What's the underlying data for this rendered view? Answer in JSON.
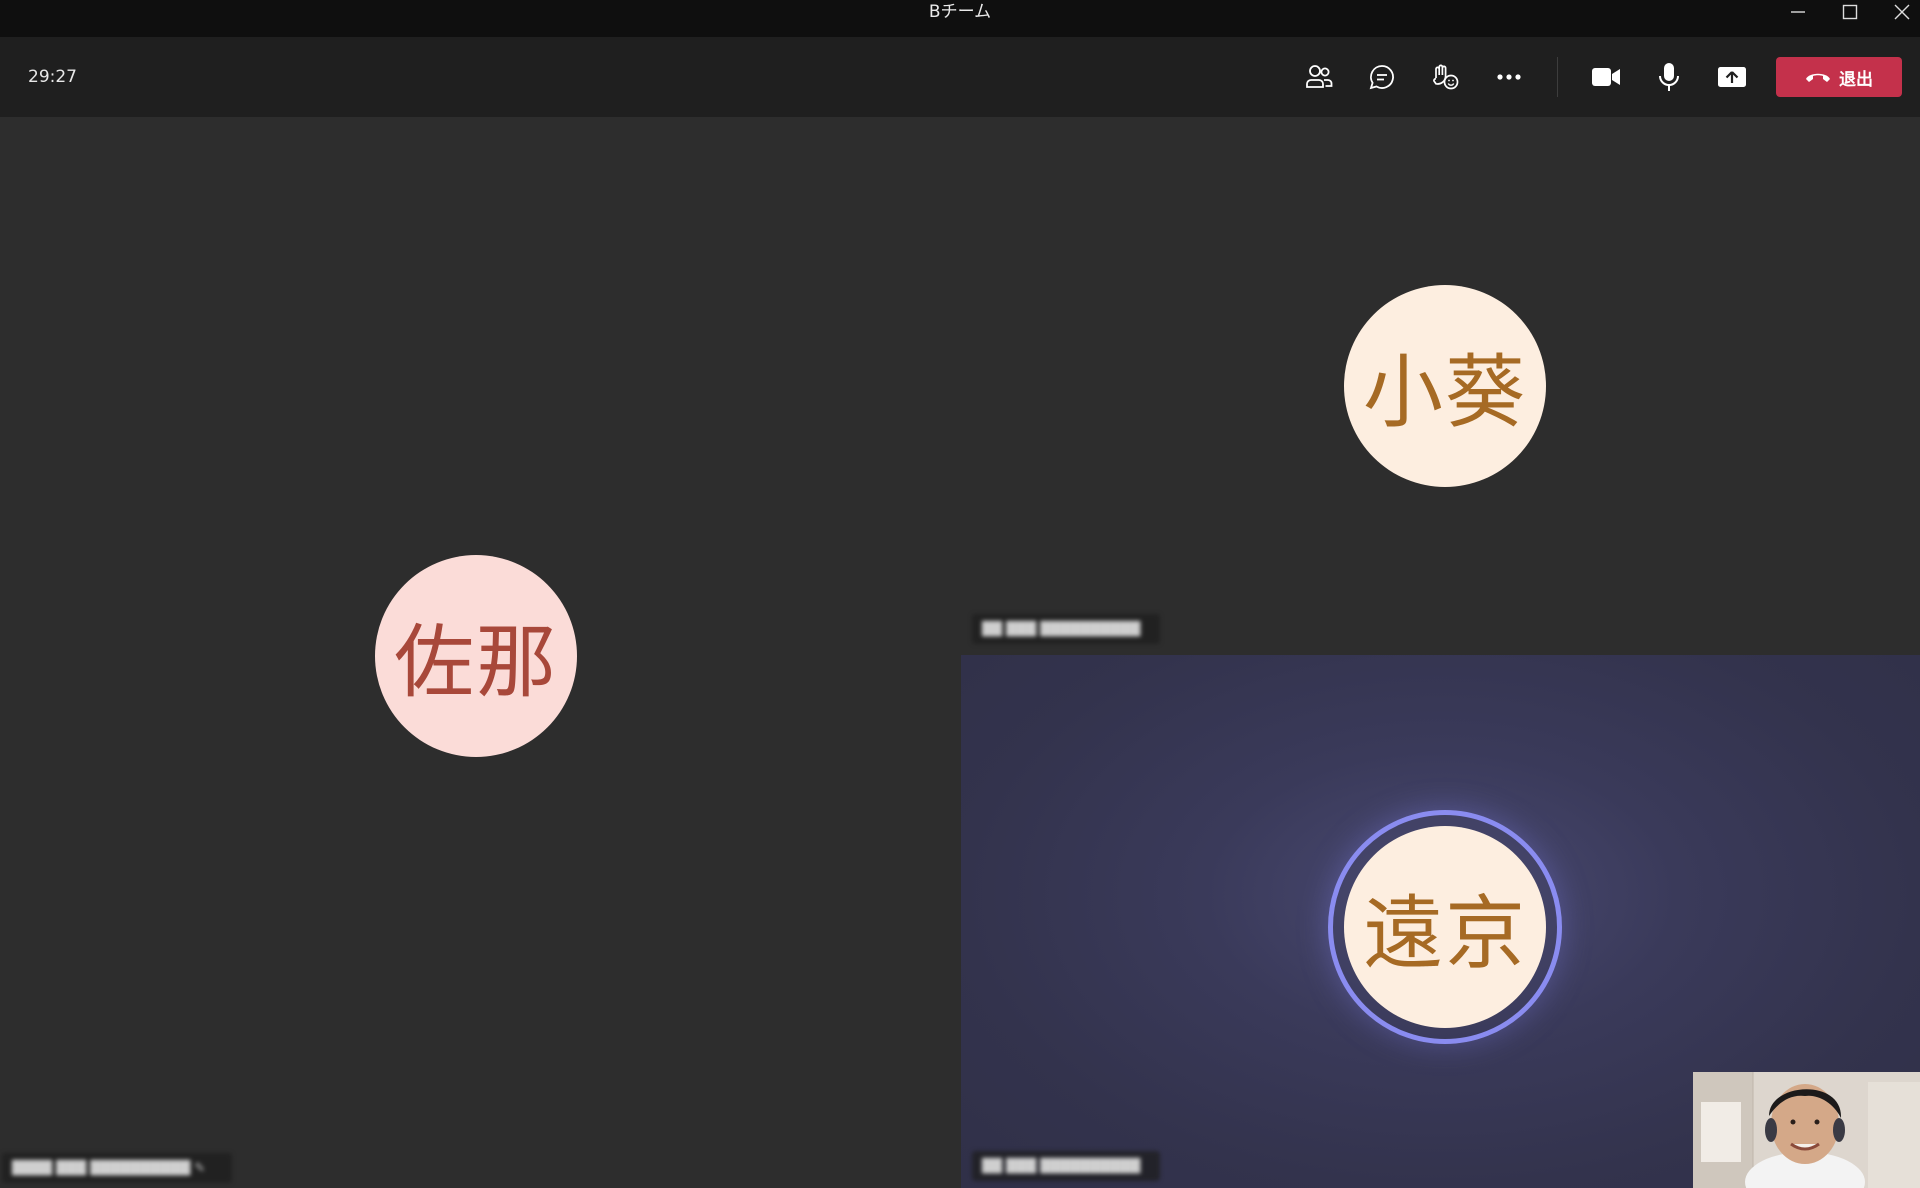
{
  "window": {
    "title": "Bチーム"
  },
  "toolbar": {
    "timer": "29:27",
    "buttons": [
      {
        "name": "participants-button",
        "icon": "people-icon"
      },
      {
        "name": "chat-button",
        "icon": "chat-icon"
      },
      {
        "name": "reactions-button",
        "icon": "raise-hand-reactions-icon"
      },
      {
        "name": "more-actions-button",
        "icon": "more-icon"
      },
      {
        "name": "camera-button",
        "icon": "video-camera-icon"
      },
      {
        "name": "mic-button",
        "icon": "microphone-icon"
      },
      {
        "name": "share-button",
        "icon": "share-screen-icon"
      }
    ],
    "leave_label": "退出",
    "leave_color": "#c4314b"
  },
  "participants": [
    {
      "initials": "佐那",
      "avatar_color": "#fbdcd8",
      "text_color": "#a8483a",
      "speaking": false,
      "name_blurred": true
    },
    {
      "initials": "小葵",
      "avatar_color": "#fdeee0",
      "text_color": "#a66a24",
      "speaking": false,
      "name_blurred": true
    },
    {
      "initials": "遠京",
      "avatar_color": "#fdeee0",
      "text_color": "#a66a24",
      "speaking": true,
      "ring_color": "#8a8cf0",
      "name_blurred": true
    }
  ],
  "self_view": {
    "type": "camera-preview"
  }
}
